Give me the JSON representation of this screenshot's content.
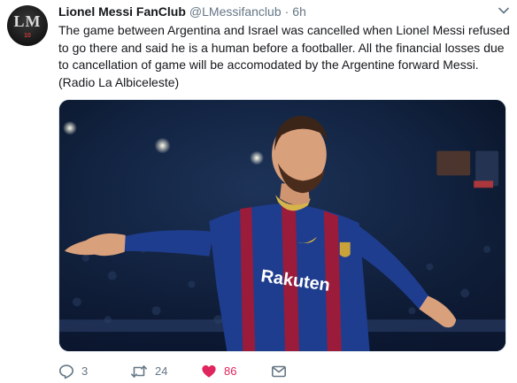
{
  "tweet": {
    "author": {
      "name": "Lionel Messi FanClub",
      "handle": "@LMessifanclub",
      "avatar_monogram": "LM",
      "avatar_number": "10"
    },
    "separator": "·",
    "time": "6h",
    "text_lines": [
      "The game between Argentina and Israel was cancelled when Lionel Messi refused",
      "to go there and said he is a human before a footballer. All the financial losses due",
      "to cancellation of game will be accomodated by the Argentine forward Messi.",
      "(Radio La Albiceleste)"
    ],
    "media": {
      "shirt_sponsor": "Rakuten"
    },
    "actions": {
      "reply_count": "3",
      "retweet_count": "24",
      "like_count": "86"
    }
  },
  "colors": {
    "text_primary": "#14171a",
    "text_secondary": "#657786",
    "like_active": "#e0245e",
    "icon_gray": "#657786",
    "shirt_blue": "#1f3d8f",
    "shirt_garnet": "#9b1b3b"
  },
  "icons": {
    "reply": "reply-icon",
    "retweet": "retweet-icon",
    "like": "heart-icon",
    "dm": "envelope-icon",
    "more": "chevron-down-icon"
  }
}
